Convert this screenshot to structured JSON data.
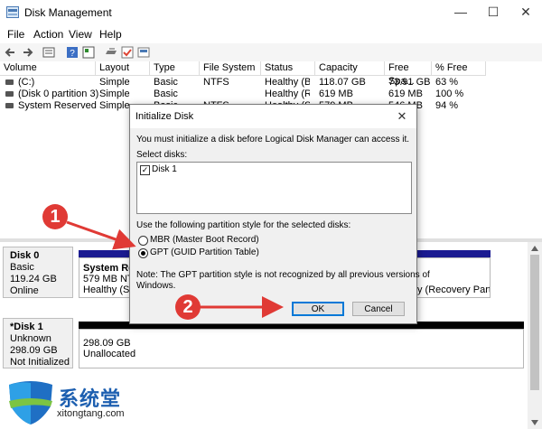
{
  "window": {
    "title": "Disk Management",
    "controls": {
      "minimize": "—",
      "maximize": "☐",
      "close": "✕"
    }
  },
  "menu": [
    "File",
    "Action",
    "View",
    "Help"
  ],
  "toolbar": [
    "back-icon",
    "forward-icon",
    "list-view-icon",
    "help-icon",
    "properties-icon",
    "connect-icon",
    "check-icon",
    "volume-icon"
  ],
  "volume_table": {
    "columns": [
      "Volume",
      "Layout",
      "Type",
      "File System",
      "Status",
      "Capacity",
      "Free Spa...",
      "% Free"
    ],
    "rows": [
      [
        "(C:)",
        "Simple",
        "Basic",
        "NTFS",
        "Healthy (B...",
        "118.07 GB",
        "73.91 GB",
        "63 %"
      ],
      [
        "(Disk 0 partition 3)",
        "Simple",
        "Basic",
        "",
        "Healthy (R...",
        "619 MB",
        "619 MB",
        "100 %"
      ],
      [
        "System Reserved",
        "Simple",
        "Basic",
        "NTFS",
        "Healthy (S...",
        "579 MB",
        "546 MB",
        "94 %"
      ]
    ]
  },
  "disks": [
    {
      "name": "Disk 0",
      "lines": [
        "Basic",
        "119.24 GB",
        "Online"
      ],
      "partitions": [
        {
          "title": "System Res",
          "line2": "579 MB NTF",
          "line3": "Healthy (Sys"
        },
        {
          "title": "",
          "line2": "",
          "line3": "y (Recovery Partitio"
        }
      ]
    },
    {
      "name": "*Disk 1",
      "lines": [
        "Unknown",
        "298.09 GB",
        "Not Initialized"
      ],
      "partitions": [
        {
          "title": "298.09 GB",
          "line2": "Unallocated"
        }
      ]
    }
  ],
  "dialog": {
    "title": "Initialize Disk",
    "intro": "You must initialize a disk before Logical Disk Manager can access it.",
    "select_label": "Select disks:",
    "disk_item": "Disk 1",
    "style_label": "Use the following partition style for the selected disks:",
    "options": [
      "MBR (Master Boot Record)",
      "GPT (GUID Partition Table)"
    ],
    "selected_option": 1,
    "note_line1": "Note: The GPT partition style is not recognized by all previous versions of",
    "note_line2": "Windows.",
    "ok_label": "OK",
    "cancel_label": "Cancel"
  },
  "callouts": [
    "1",
    "2"
  ],
  "watermark": {
    "text_cn": "系统堂",
    "text_en": "xitongtang.com"
  },
  "colors": {
    "accent": "#0078d7",
    "callout": "#e03a35",
    "partition_bar": "#1b1b91",
    "unallocated_bar": "#000000"
  }
}
